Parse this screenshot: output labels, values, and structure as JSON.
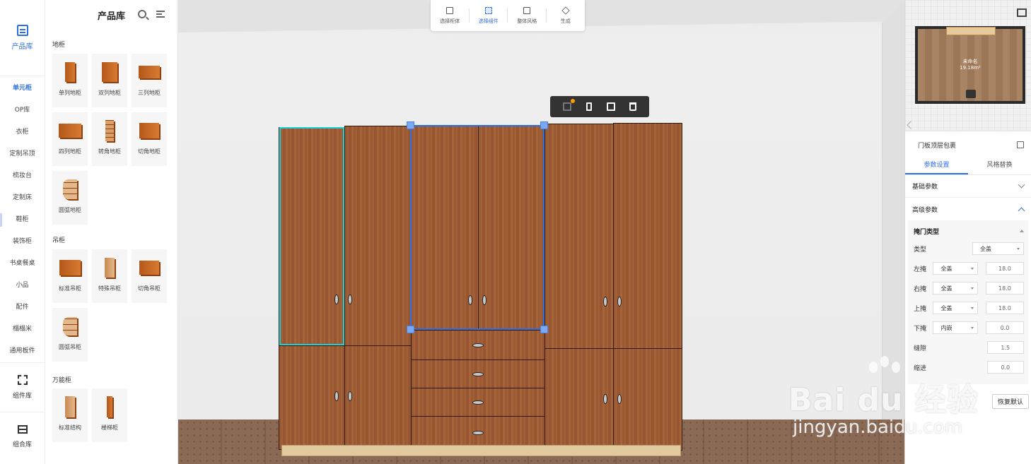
{
  "left_rail": {
    "top_label": "产品库",
    "categories": [
      "单元柜",
      "OP库",
      "衣柜",
      "定制吊顶",
      "梳妆台",
      "定制床",
      "鞋柜",
      "装饰柜",
      "书桌餐桌",
      "小品",
      "配件",
      "榻榻米",
      "通用板件"
    ],
    "component_lib_label": "组件库",
    "combo_lib_label": "组合库"
  },
  "product_panel": {
    "title": "产品库",
    "sections": [
      {
        "title": "地柜",
        "items": [
          "单列地柜",
          "双列地柜",
          "三列地柜",
          "四列地柜",
          "转角地柜",
          "切角地柜",
          "圆弧地柜"
        ]
      },
      {
        "title": "吊柜",
        "items": [
          "标准吊柜",
          "特殊吊柜",
          "切角吊柜",
          "圆弧吊柜"
        ]
      },
      {
        "title": "万能柜",
        "items": [
          "标准结构",
          "楼梯柜"
        ]
      }
    ]
  },
  "top_toolbar": {
    "buttons": [
      "选择柜体",
      "选择组件",
      "整体风格",
      "生成"
    ],
    "active_index": 1
  },
  "minimap": {
    "room_name": "未命名",
    "room_area": "19.18m²"
  },
  "props": {
    "title": "门板顶层包裹",
    "tabs": [
      "参数设置",
      "风格替换"
    ],
    "active_tab": 0,
    "basic_label": "基础参数",
    "advanced_label": "高级参数",
    "group_title": "掩门类型",
    "type_label": "类型",
    "type_value": "全盖",
    "rows": [
      {
        "label": "左掩",
        "select": "全盖",
        "value": "18.0"
      },
      {
        "label": "右掩",
        "select": "全盖",
        "value": "18.0"
      },
      {
        "label": "上掩",
        "select": "全盖",
        "value": "18.0"
      },
      {
        "label": "下掩",
        "select": "内嵌",
        "value": "0.0"
      }
    ],
    "gap_label": "缝隙",
    "gap_value": "1.5",
    "indent_label": "缩进",
    "indent_value": "0.0",
    "reset_label": "恢复默认"
  },
  "watermark": {
    "brand": "Bai du 经验",
    "url": "jingyan.baidu.com"
  },
  "colors": {
    "accent": "#2f6fe4",
    "selection_cyan": "#22d0d8",
    "wood": "#9c5a33"
  }
}
